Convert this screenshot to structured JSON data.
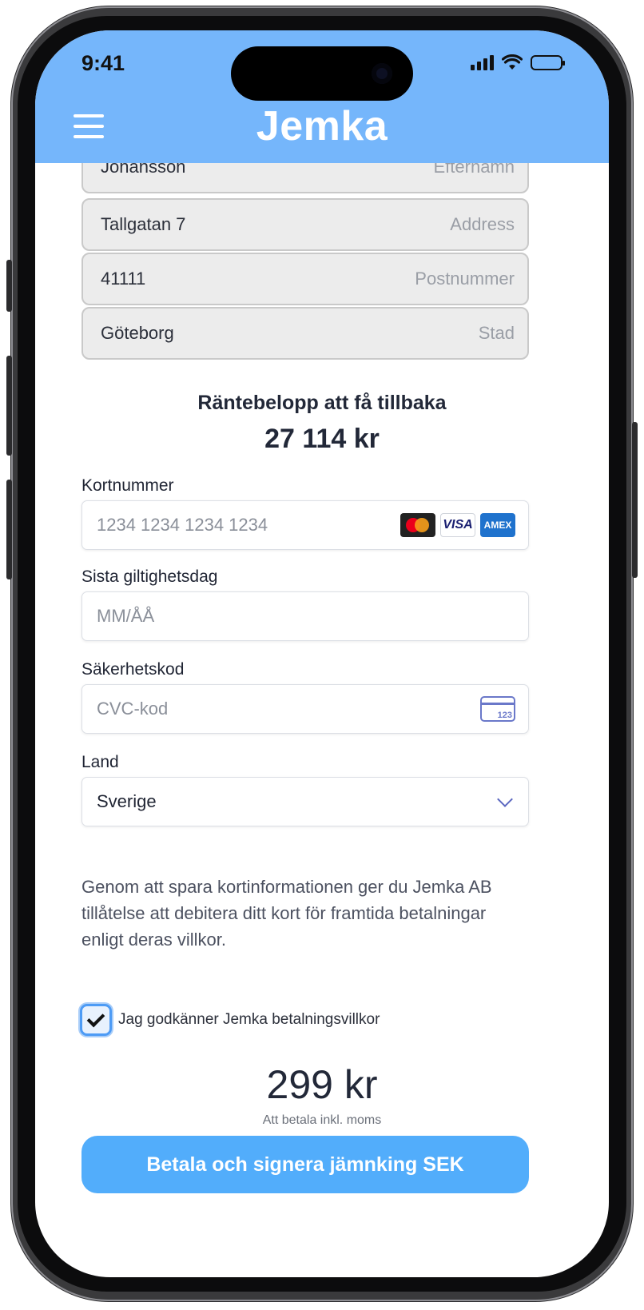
{
  "status_bar": {
    "time": "9:41"
  },
  "header": {
    "logo": "Jemka"
  },
  "form": {
    "lastname": {
      "value": "Johansson",
      "placeholder": "Efternamn"
    },
    "address": {
      "value": "Tallgatan 7",
      "placeholder": "Address"
    },
    "postcode": {
      "value": "41111",
      "placeholder": "Postnummer"
    },
    "city": {
      "value": "Göteborg",
      "placeholder": "Stad"
    }
  },
  "refund": {
    "title": "Räntebelopp att få tillbaka",
    "amount": "27 114 kr"
  },
  "payment": {
    "card_number_label": "Kortnummer",
    "card_number_placeholder": "1234 1234 1234 1234",
    "card_brands": [
      "mastercard",
      "VISA",
      "AMEX"
    ],
    "expiry_label": "Sista giltighetsdag",
    "expiry_placeholder": "MM/ÅÅ",
    "cvc_label": "Säkerhetskod",
    "cvc_placeholder": "CVC-kod",
    "cvc_icon_text": "123",
    "country_label": "Land",
    "country_value": "Sverige"
  },
  "terms": {
    "text": "Genom att spara kortinformationen ger du Jemka AB tillåtelse att debitera ditt kort för framtida betalningar enligt deras villkor.",
    "checkbox_label": "Jag godkänner Jemka betalningsvillkor",
    "checked": true
  },
  "total": {
    "price": "299 kr",
    "note": "Att betala inkl. moms"
  },
  "pay_button": {
    "label": "Betala och signera jämnking SEK"
  },
  "colors": {
    "header_bg": "#75b6fb",
    "button_bg": "#52adfb",
    "checkbox_accent": "#4d9bf5"
  },
  "icons": [
    "hamburger-menu-icon",
    "signal-icon",
    "wifi-icon",
    "battery-icon",
    "credit-card-cvc-icon",
    "chevron-down-icon",
    "checkmark-icon"
  ]
}
